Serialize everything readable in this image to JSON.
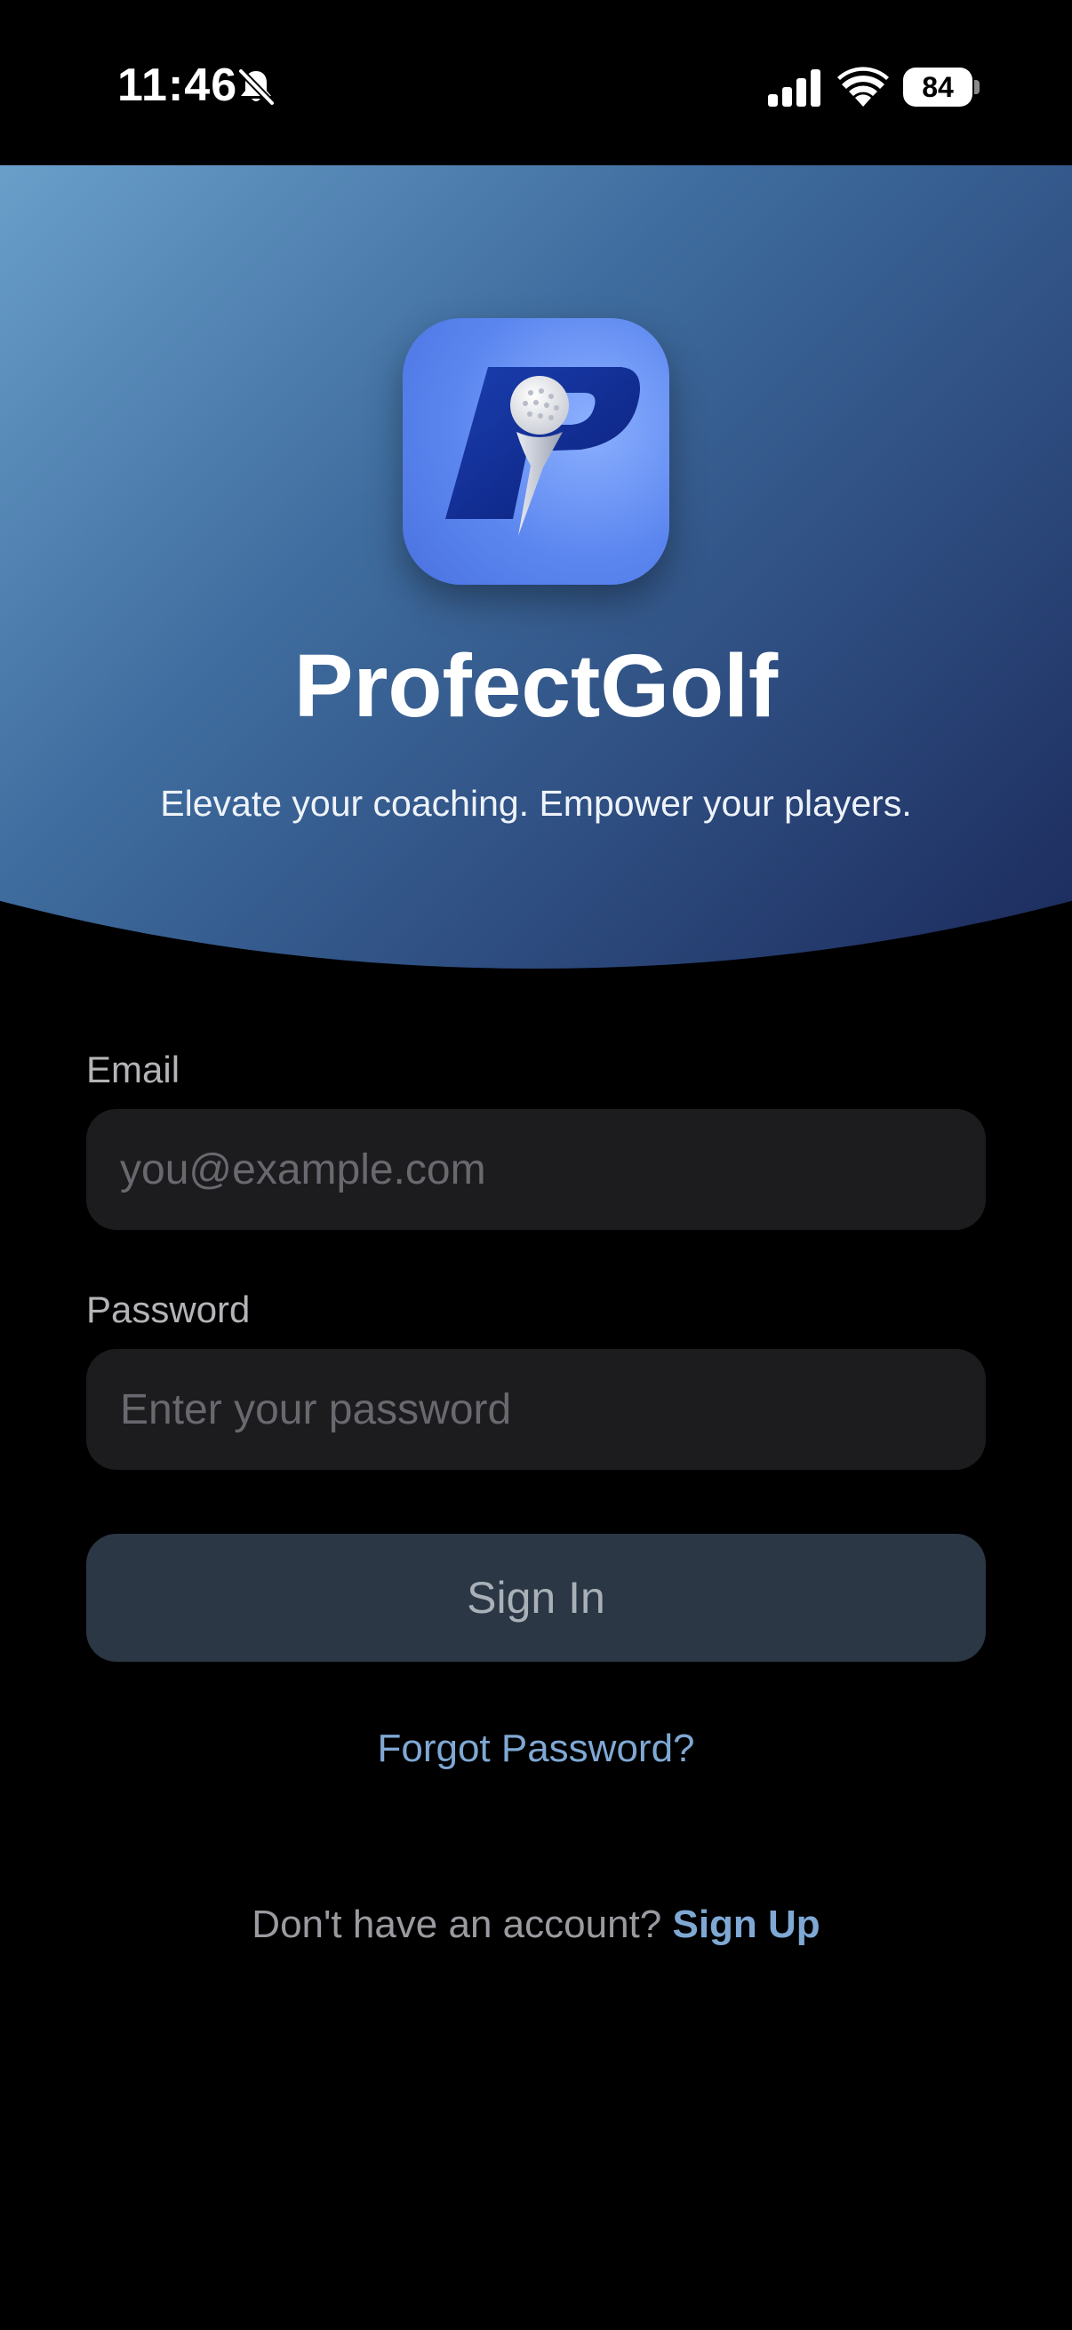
{
  "status_bar": {
    "time": "11:46",
    "battery_level": "84",
    "icons": [
      "bell-slash-icon",
      "cellular-signal-icon",
      "wifi-icon",
      "battery-icon"
    ]
  },
  "hero": {
    "app_name": "ProfectGolf",
    "tagline": "Elevate your coaching. Empower your players.",
    "gradient_colors": [
      "#6a9fca",
      "#3f6d9f",
      "#2e4d80",
      "#1c2a5c"
    ],
    "logo_icon": "golf-ball-tee-p-logo"
  },
  "form": {
    "email_label": "Email",
    "email_placeholder": "you@example.com",
    "email_value": "",
    "password_label": "Password",
    "password_placeholder": "Enter your password",
    "password_value": "",
    "sign_in_label": "Sign In",
    "forgot_password_label": "Forgot Password?",
    "signup_prompt": "Don't have an account?",
    "signup_link": "Sign Up"
  },
  "colors": {
    "background": "#000000",
    "input_background": "#1c1c1e",
    "button_background": "#2b3744",
    "link": "#7fa8d4"
  }
}
